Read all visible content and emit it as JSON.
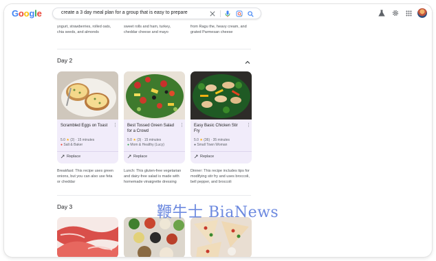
{
  "app": {
    "logo": "Google"
  },
  "search": {
    "query": "create a 3 day meal plan for a group that is easy to prepare"
  },
  "day1_snippets": [
    "Breakfast: This recipe uses Greek yogurt, strawberries, rolled oats, chia seeds, and almonds",
    "Lunch: This recipe uses Hawaiian sweet rolls and ham, turkey, cheddar cheese and mayo",
    "Dinner: This recipe uses a recipe from Ragu the, heavy cream, and grated Parmesan cheese"
  ],
  "day2": {
    "title": "Day 2",
    "cards": [
      {
        "title": "Scrambled Eggs on Toast",
        "rating": "5.0",
        "reviews": "(2)",
        "time": "15 minutes",
        "source": "Salt & Baker",
        "replace": "Replace",
        "snippet": "Breakfast: This recipe uses green onions, but you can also use feta or cheddar"
      },
      {
        "title": "Best Tossed Green Salad for a Crowd",
        "rating": "5.0",
        "reviews": "(3)",
        "time": "15 minutes",
        "source": "Mom & Healthy (Lucy)",
        "replace": "Replace",
        "snippet": "Lunch: This gluten-free vegetarian and dairy-free salad is made with homemade vinaigrette dressing"
      },
      {
        "title": "Easy Basic Chicken Stir Fry",
        "rating": "5.0",
        "reviews": "(36)",
        "time": "35 minutes",
        "source": "Small Town Woman",
        "replace": "Replace",
        "snippet": "Dinner: This recipe includes tips for modifying stir fry and uses broccoli, bell pepper, and broccoli"
      }
    ]
  },
  "day3": {
    "title": "Day 3"
  },
  "icons": {
    "clear": "close-icon",
    "mic": "microphone-icon",
    "lens": "lens-icon",
    "search": "search-icon",
    "labs": "flask-icon",
    "settings": "gear-icon",
    "apps": "apps-grid-icon",
    "chevron": "chevron-up-icon",
    "replace": "sparkle-replace-icon",
    "star": "star-icon"
  },
  "colors": {
    "card_bg": "#f1ecfa",
    "accent_blue": "#1a73e8",
    "star": "#f9ab00"
  },
  "watermark": "鞭牛士 BiaNews"
}
